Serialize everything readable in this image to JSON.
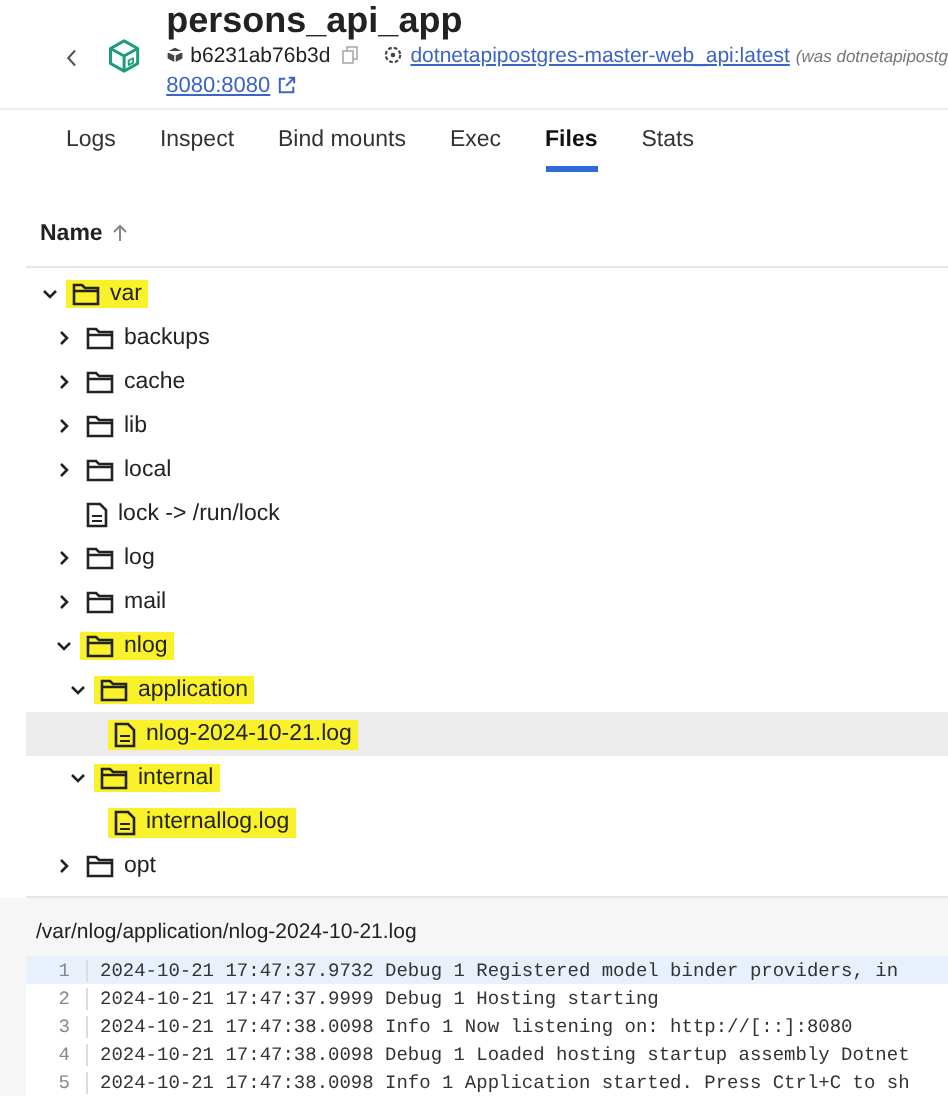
{
  "header": {
    "title": "persons_api_app",
    "container_id": "b6231ab76b3d",
    "image_link": "dotnetapipostgres-master-web_api:latest",
    "image_note": "(was dotnetapipostg",
    "port_link": "8080:8080"
  },
  "tabs": [
    {
      "label": "Logs",
      "selected": false
    },
    {
      "label": "Inspect",
      "selected": false
    },
    {
      "label": "Bind mounts",
      "selected": false
    },
    {
      "label": "Exec",
      "selected": false
    },
    {
      "label": "Files",
      "selected": true
    },
    {
      "label": "Stats",
      "selected": false
    }
  ],
  "file_table": {
    "column": "Name"
  },
  "tree": [
    {
      "name": "var",
      "kind": "folder",
      "expanded": true,
      "highlighted": true,
      "selected": false,
      "children": [
        {
          "name": "backups",
          "kind": "folder",
          "expanded": false,
          "highlighted": false,
          "selected": false
        },
        {
          "name": "cache",
          "kind": "folder",
          "expanded": false,
          "highlighted": false,
          "selected": false
        },
        {
          "name": "lib",
          "kind": "folder",
          "expanded": false,
          "highlighted": false,
          "selected": false
        },
        {
          "name": "local",
          "kind": "folder",
          "expanded": false,
          "highlighted": false,
          "selected": false
        },
        {
          "name": "lock -> /run/lock",
          "kind": "file",
          "highlighted": false,
          "selected": false
        },
        {
          "name": "log",
          "kind": "folder",
          "expanded": false,
          "highlighted": false,
          "selected": false
        },
        {
          "name": "mail",
          "kind": "folder",
          "expanded": false,
          "highlighted": false,
          "selected": false
        },
        {
          "name": "nlog",
          "kind": "folder",
          "expanded": true,
          "highlighted": true,
          "selected": false,
          "children": [
            {
              "name": "application",
              "kind": "folder",
              "expanded": true,
              "highlighted": true,
              "selected": false,
              "children": [
                {
                  "name": "nlog-2024-10-21.log",
                  "kind": "file",
                  "highlighted": true,
                  "selected": true
                }
              ]
            },
            {
              "name": "internal",
              "kind": "folder",
              "expanded": true,
              "highlighted": true,
              "selected": false,
              "children": [
                {
                  "name": "internallog.log",
                  "kind": "file",
                  "highlighted": true,
                  "selected": false
                }
              ]
            }
          ]
        },
        {
          "name": "opt",
          "kind": "folder",
          "expanded": false,
          "highlighted": false,
          "selected": false
        }
      ]
    }
  ],
  "file_viewer": {
    "path": "/var/nlog/application/nlog-2024-10-21.log",
    "lines": [
      {
        "number": "1",
        "text": "2024-10-21 17:47:37.9732 Debug 1 Registered model binder providers, in",
        "current": true
      },
      {
        "number": "2",
        "text": "2024-10-21 17:47:37.9999 Debug 1 Hosting starting",
        "current": false
      },
      {
        "number": "3",
        "text": "2024-10-21 17:47:38.0098 Info 1 Now listening on: http://[::]:8080",
        "current": false
      },
      {
        "number": "4",
        "text": "2024-10-21 17:47:38.0098 Debug 1 Loaded hosting startup assembly Dotnet",
        "current": false
      },
      {
        "number": "5",
        "text": "2024-10-21 17:47:38.0098 Info 1 Application started. Press Ctrl+C to sh",
        "current": false
      }
    ]
  }
}
